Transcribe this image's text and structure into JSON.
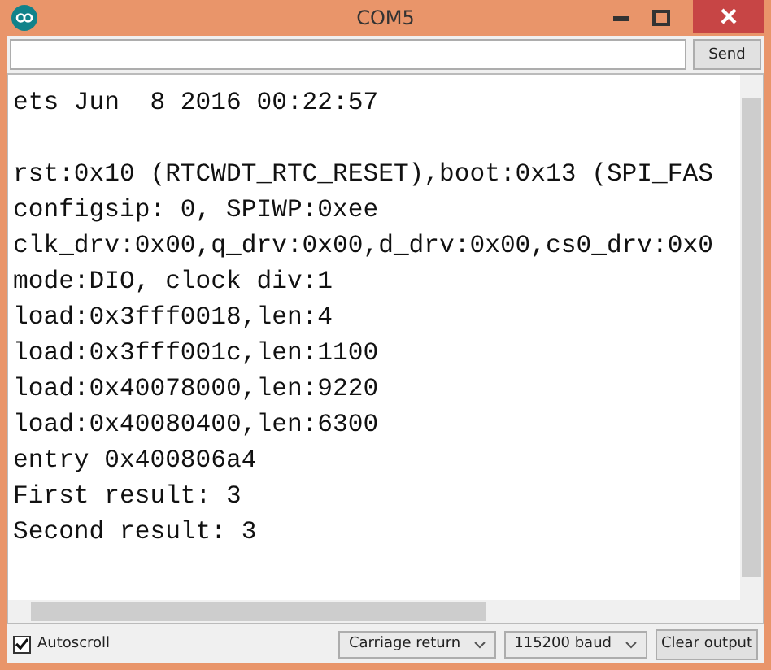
{
  "window": {
    "title": "COM5"
  },
  "send_bar": {
    "button": "Send"
  },
  "output": {
    "header_line": "ets Jun  8 2016 00:22:57",
    "lines": [
      "rst:0x10 (RTCWDT_RTC_RESET),boot:0x13 (SPI_FAS",
      "configsip: 0, SPIWP:0xee",
      "clk_drv:0x00,q_drv:0x00,d_drv:0x00,cs0_drv:0x0",
      "mode:DIO, clock div:1",
      "load:0x3fff0018,len:4",
      "load:0x3fff001c,len:1100",
      "load:0x40078000,len:9220",
      "load:0x40080400,len:6300",
      "entry 0x400806a4",
      "First result: 3",
      "Second result: 3"
    ]
  },
  "footer": {
    "autoscroll": {
      "label": "Autoscroll",
      "checked": true
    },
    "line_ending": "Carriage return",
    "baud": "115200 baud",
    "clear_button": "Clear output"
  }
}
